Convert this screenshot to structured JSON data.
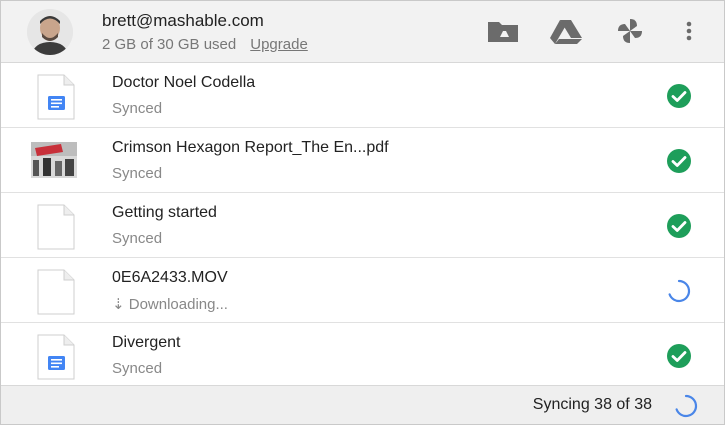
{
  "account": {
    "email": "brett@mashable.com",
    "usage": "2 GB of 30 GB used",
    "upgrade_label": "Upgrade"
  },
  "header_icons": [
    "drive-folder-icon",
    "drive-logo-icon",
    "photos-pinwheel-icon",
    "more-vert-icon"
  ],
  "files": [
    {
      "name": "Doctor Noel Codella",
      "status": "Synced",
      "thumb": "google-doc-icon",
      "state": "synced"
    },
    {
      "name": "Crimson Hexagon Report_The En...pdf",
      "status": "Synced",
      "thumb": "pdf-thumbnail",
      "state": "synced"
    },
    {
      "name": "Getting started",
      "status": "Synced",
      "thumb": "blank-file-icon",
      "state": "synced"
    },
    {
      "name": "0E6A2433.MOV",
      "status": "⇣ Downloading...",
      "thumb": "blank-file-icon",
      "state": "downloading"
    },
    {
      "name": "Divergent",
      "status": "Synced",
      "thumb": "google-doc-icon",
      "state": "synced"
    }
  ],
  "footer": {
    "sync_status": "Syncing 38 of 38"
  },
  "colors": {
    "synced_green": "#1e9e5a",
    "spinner_blue": "#4a86e8",
    "doc_blue": "#4285f4"
  }
}
